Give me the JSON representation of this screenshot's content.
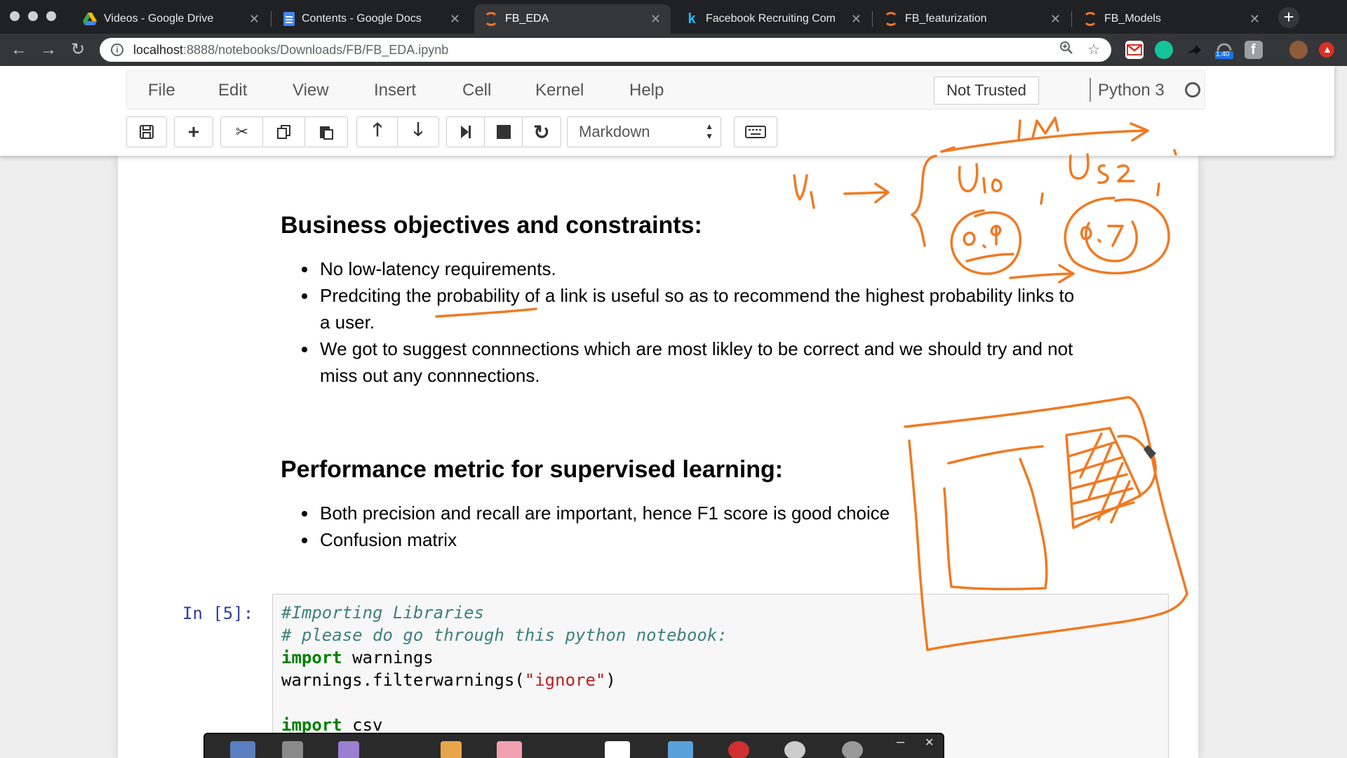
{
  "browser": {
    "tabs": [
      {
        "title": "Videos - Google Drive",
        "icon": "google-drive-icon",
        "active": false
      },
      {
        "title": "Contents - Google Docs",
        "icon": "google-docs-icon",
        "active": false
      },
      {
        "title": "FB_EDA",
        "icon": "jupyter-icon",
        "active": true
      },
      {
        "title": "Facebook Recruiting Com",
        "icon": "kaggle-icon",
        "active": false
      },
      {
        "title": "FB_featurization",
        "icon": "jupyter-icon",
        "active": false
      },
      {
        "title": "FB_Models",
        "icon": "jupyter-icon",
        "active": false
      }
    ],
    "url_host": "localhost",
    "url_path": ":8888/notebooks/Downloads/FB/FB_EDA.ipynb",
    "extension_badge": "1.40"
  },
  "jupyter": {
    "menu": [
      "File",
      "Edit",
      "View",
      "Insert",
      "Cell",
      "Kernel",
      "Help"
    ],
    "trusted_label": "Not Trusted",
    "kernel_name": "Python 3",
    "cell_type": "Markdown"
  },
  "notebook": {
    "section1_title": "Business objectives and constraints:",
    "section1_items": [
      "No low-latency requirements.",
      "Predciting the probability of a link is useful so as to recommend the highest probability links to",
      "a user.",
      "We got to suggest connnections which are most likley to be correct and we should try and not",
      "miss out any connnections."
    ],
    "section2_title": "Performance metric for supervised learning:",
    "section2_items": [
      "Both precision and recall are important, hence F1 score is good choice",
      "Confusion matrix"
    ],
    "prompt": "In [5]:",
    "code": {
      "line1": "#Importing Libraries",
      "line2": "# please do go through this python notebook:",
      "kw_import": "import",
      "mod_warnings": " warnings",
      "filter_call": "warnings.filterwarnings(",
      "filter_arg": "\"ignore\"",
      "filter_close": ")",
      "mod_csv": " csv"
    }
  },
  "colors": {
    "annotation": "#f07a22",
    "prompt": "#303f9f",
    "keyword": "#008000",
    "string": "#ba2121",
    "comment": "#408080"
  }
}
